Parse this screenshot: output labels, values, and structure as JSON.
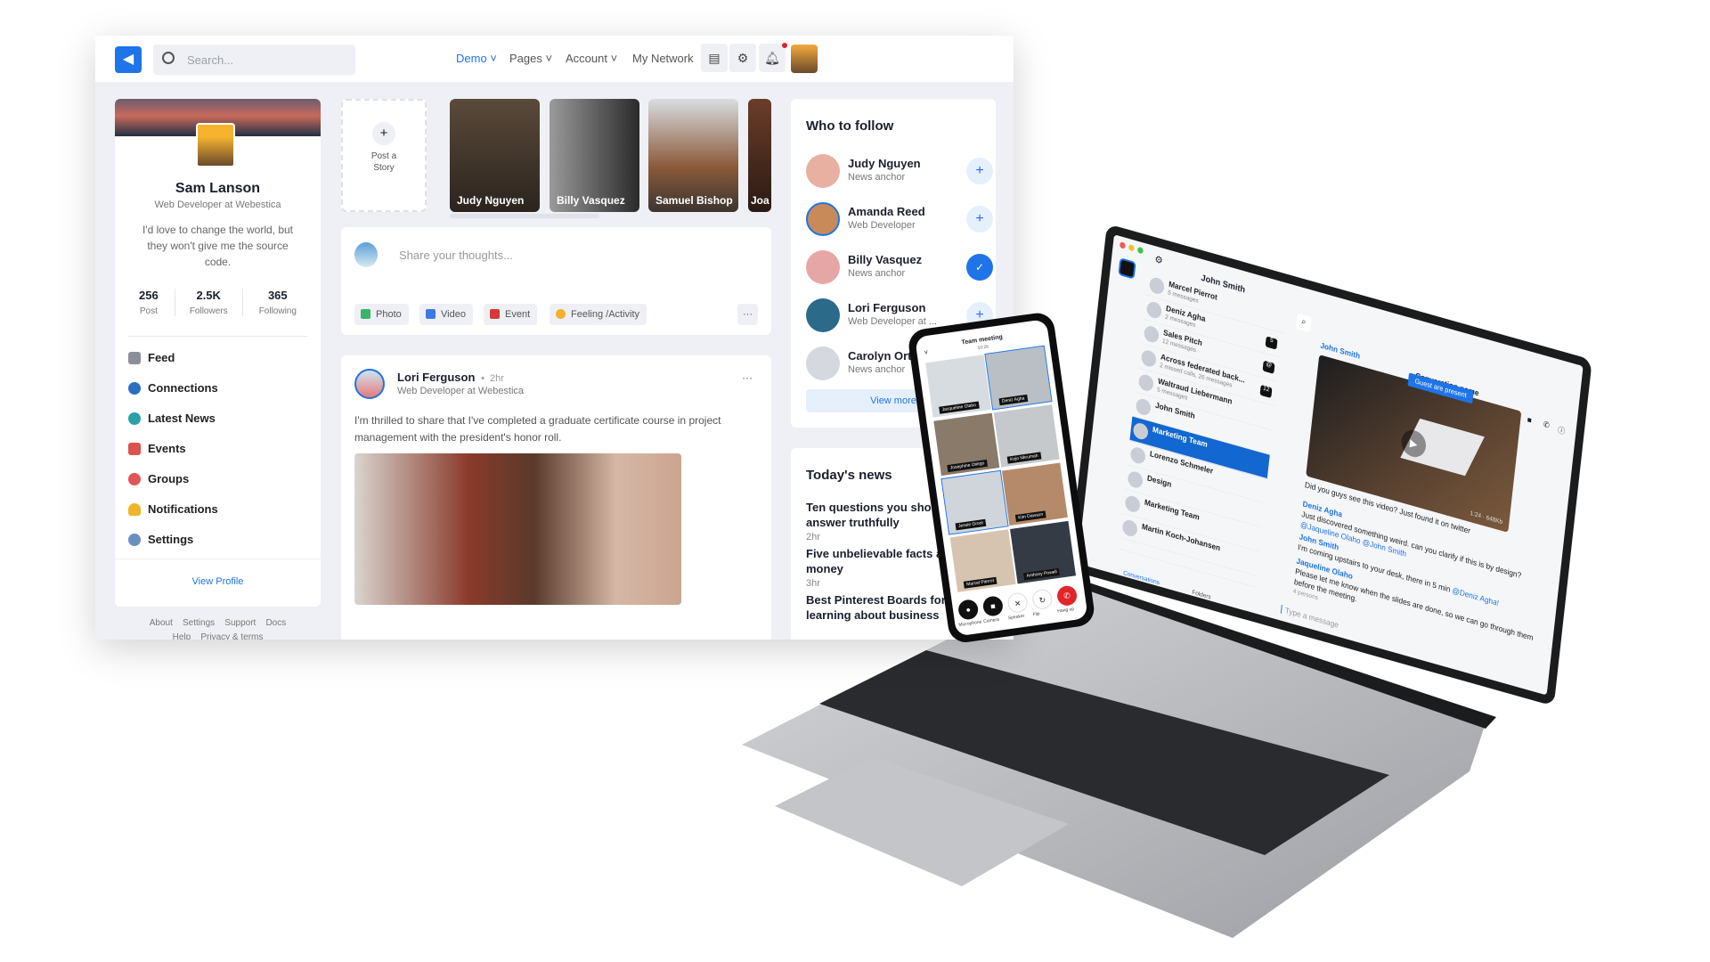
{
  "header": {
    "search_placeholder": "Search...",
    "nav": [
      "Demo",
      "Pages",
      "Account",
      "My Network"
    ],
    "icons": [
      "chat-icon",
      "gear-icon",
      "bell-icon"
    ]
  },
  "profile": {
    "name": "Sam Lanson",
    "title": "Web Developer at Webestica",
    "bio": "I'd love to change the world, but they won't give me the source code.",
    "stats": [
      {
        "value": "256",
        "label": "Post"
      },
      {
        "value": "2.5K",
        "label": "Followers"
      },
      {
        "value": "365",
        "label": "Following"
      }
    ],
    "menu": [
      "Feed",
      "Connections",
      "Latest News",
      "Events",
      "Groups",
      "Notifications",
      "Settings"
    ],
    "view_profile": "View Profile",
    "footer": [
      "About",
      "Settings",
      "Support",
      "Docs",
      "Help",
      "Privacy & terms"
    ]
  },
  "stories": {
    "post_label": "Post a Story",
    "items": [
      "Judy Nguyen",
      "Billy Vasquez",
      "Samuel Bishop",
      "Joa"
    ]
  },
  "composer": {
    "placeholder": "Share your thoughts...",
    "actions": [
      "Photo",
      "Video",
      "Event",
      "Feeling /Activity"
    ],
    "more": "···"
  },
  "post": {
    "author": "Lori Ferguson",
    "time": "2hr",
    "subtitle": "Web Developer at Webestica",
    "body": "I'm thrilled to share that I've completed a graduate certificate course in project management with the president's honor roll.",
    "more": "···"
  },
  "follow": {
    "title": "Who to follow",
    "people": [
      {
        "name": "Judy Nguyen",
        "role": "News anchor"
      },
      {
        "name": "Amanda Reed",
        "role": "Web Developer"
      },
      {
        "name": "Billy Vasquez",
        "role": "News anchor"
      },
      {
        "name": "Lori Ferguson",
        "role": "Web Developer at ..."
      },
      {
        "name": "Carolyn Ortiz",
        "role": "News anchor"
      }
    ],
    "view_more": "View more"
  },
  "news": {
    "title": "Today's news",
    "items": [
      {
        "title": "Ten questions you should answer truthfully",
        "time": "2hr"
      },
      {
        "title": "Five unbelievable facts about money",
        "time": "3hr"
      },
      {
        "title": "Best Pinterest Boards for learning about business",
        "time": ""
      }
    ]
  },
  "chat_app": {
    "user": "John Smith",
    "conversations": [
      {
        "name": "Marcel Pierrot",
        "sub": "5 messages",
        "badge": ""
      },
      {
        "name": "Deniz Agha",
        "sub": "2 messages",
        "badge": "5"
      },
      {
        "name": "Sales Pitch",
        "sub": "12 messages",
        "badge": "@"
      },
      {
        "name": "Across federated back...",
        "sub": "2 missed calls, 26 messages",
        "badge": "12"
      },
      {
        "name": "Waltraud Liebermann",
        "sub": "5 messages",
        "badge": ""
      },
      {
        "name": "John Smith",
        "sub": "",
        "badge": ""
      },
      {
        "name": "Marketing Team",
        "sub": "",
        "badge": ""
      },
      {
        "name": "Lorenzo Schmeler",
        "sub": "",
        "badge": ""
      },
      {
        "name": "Design",
        "sub": "",
        "badge": ""
      },
      {
        "name": "Marketing Team",
        "sub": "",
        "badge": ""
      },
      {
        "name": "Martin Koch-Johansen",
        "sub": "",
        "badge": ""
      }
    ],
    "tabs": [
      "Conversations",
      "Folders"
    ],
    "conversation_name": "Converation name",
    "guest_banner": "Guest are present",
    "video_meta": "1:24 · 648Kb",
    "messages": [
      {
        "author": "John Smith",
        "text": "Did you guys see this video? Just found it on twitter"
      },
      {
        "author": "Deniz Agha",
        "text": "Just discovered something weird. can you clarify if this is by design?",
        "mentions": "@Jaqueline Olaho @John Smith"
      },
      {
        "author": "John Smith",
        "text": "I'm coming upstairs to your desk, there in 5 min",
        "mentions": "@Deniz Agha!"
      },
      {
        "author": "Jaqueline Olaho",
        "text": "Please let me know when the slides are done, so we can go through them before the meeting."
      }
    ],
    "reactions": "4 persons",
    "input_placeholder": "Type a message"
  },
  "meeting": {
    "title": "Team meeting",
    "time": "10:26",
    "participants": [
      "Jacqueline Olaho",
      "Deniz Agha",
      "Josephine Otiego",
      "Kojo Nkrumah",
      "Jessie Groot",
      "Kim Dawson",
      "Marcel Pierrot",
      "Anthony Powell"
    ],
    "controls": [
      "Microphone",
      "Camera",
      "Speaker",
      "Flip",
      "Hang up"
    ]
  },
  "colors": {
    "accent": "#1e74e8",
    "background": "#eef0f5",
    "hangup": "#e0262b"
  }
}
